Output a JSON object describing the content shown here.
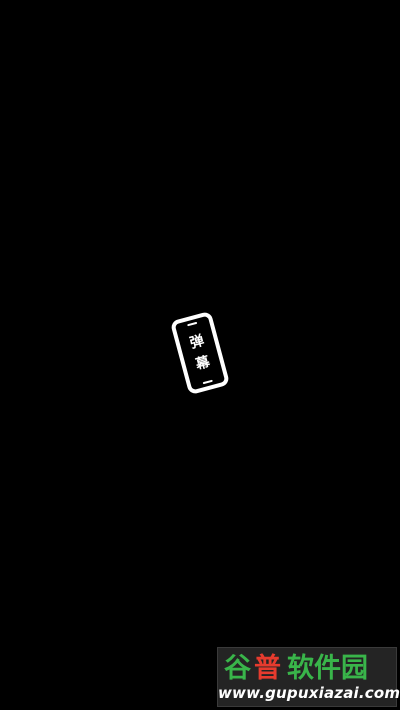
{
  "screen": {
    "background": "#000000"
  },
  "danmaku_toggle": {
    "icon": "phone-rotate-icon",
    "label_chars": [
      "弹",
      "幕"
    ],
    "color": "#ffffff"
  },
  "watermark": {
    "brand": "谷普软件园",
    "url": "www.gupuxiazai.com",
    "colors": {
      "brand_green": "#39b54a",
      "brand_red": "#e63b2e",
      "url_text": "#ffffff"
    }
  }
}
